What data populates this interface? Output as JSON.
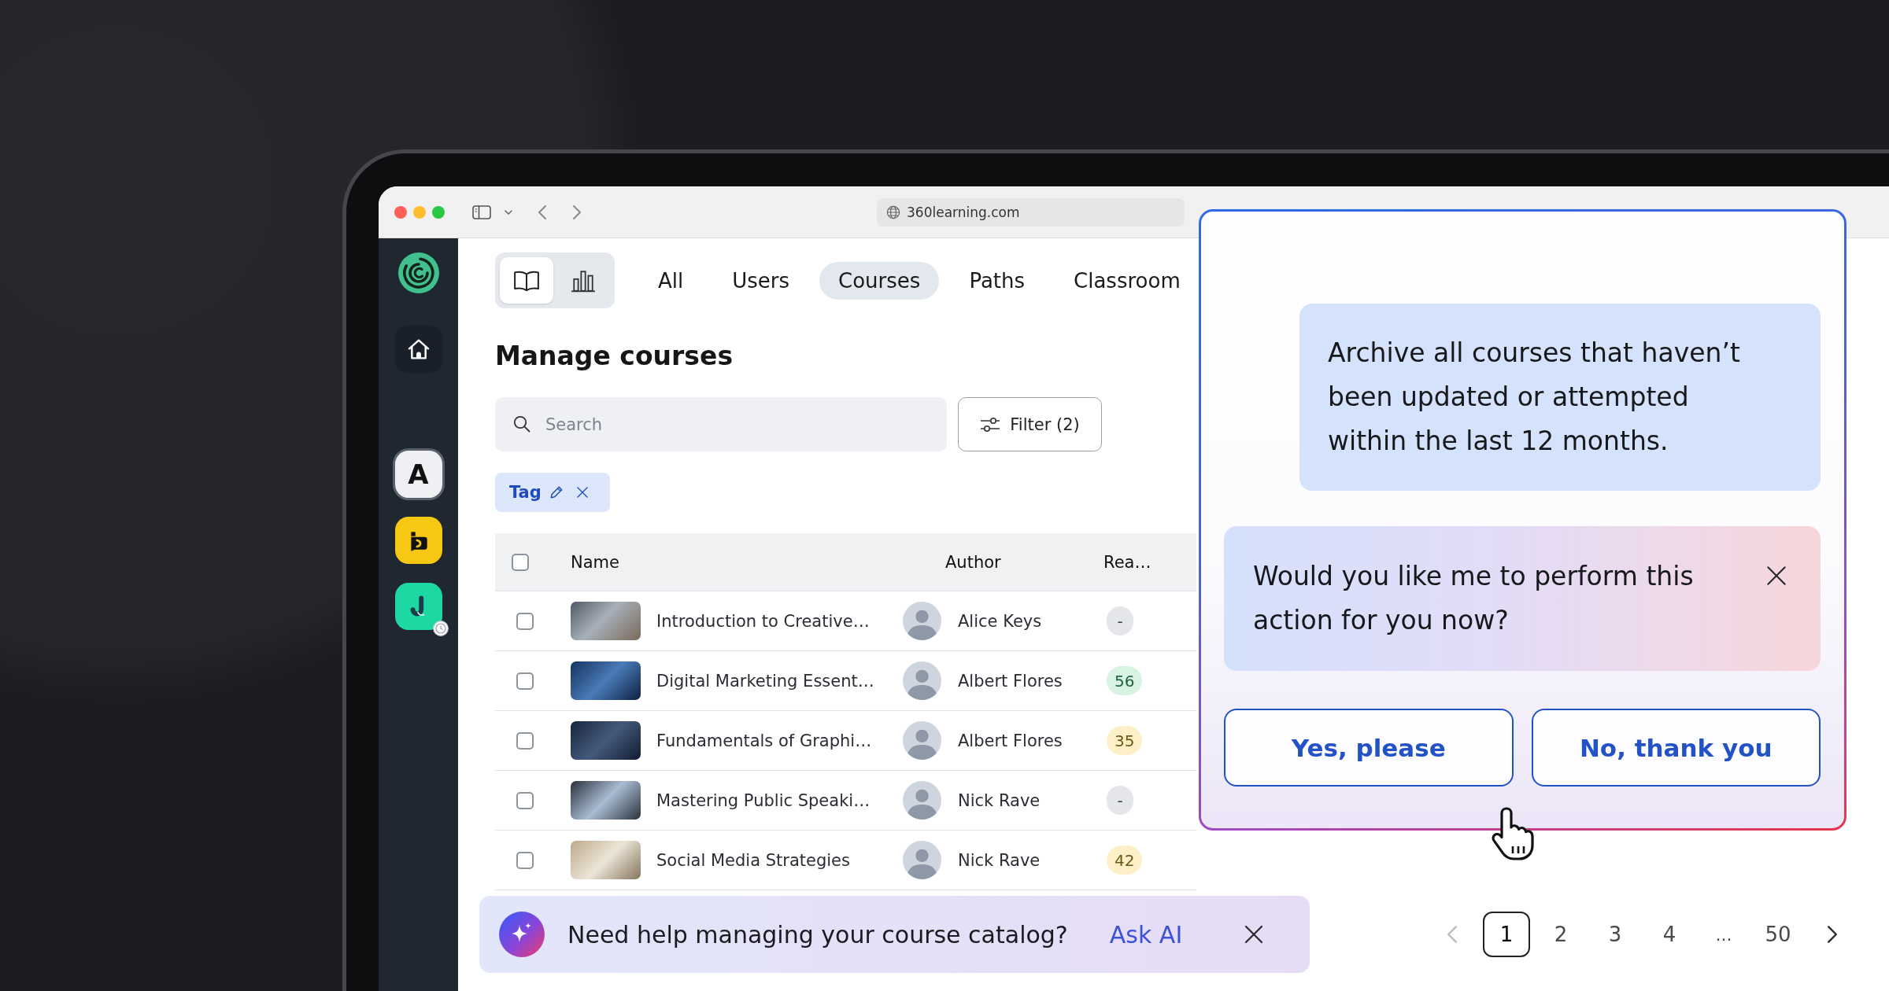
{
  "browser": {
    "url": "360learning.com"
  },
  "sidebar": {
    "apps": [
      {
        "kind": "letter",
        "label": "A",
        "color": "#eef0f4",
        "selected": true,
        "badge": false
      },
      {
        "kind": "bracket",
        "color": "#f6c814",
        "selected": false,
        "badge": false
      },
      {
        "kind": "hook",
        "color": "#1ed8a3",
        "selected": false,
        "badge": true
      }
    ]
  },
  "view_toggle": [
    {
      "kind": "book",
      "selected": true
    },
    {
      "kind": "chart",
      "selected": false
    }
  ],
  "tabs": [
    {
      "label": "All",
      "selected": false
    },
    {
      "label": "Users",
      "selected": false
    },
    {
      "label": "Courses",
      "selected": true
    },
    {
      "label": "Paths",
      "selected": false
    },
    {
      "label": "Classroom",
      "selected": false
    }
  ],
  "title": "Manage courses",
  "search": {
    "placeholder": "Search"
  },
  "filter_button": {
    "label": "Filter (2)"
  },
  "active_filters": [
    {
      "label": "Tag"
    }
  ],
  "table": {
    "select_all_checked": false,
    "columns": [
      "Name",
      "Author",
      "Rea…"
    ],
    "rows": [
      {
        "checked": false,
        "name": "Introduction to Creative…",
        "author": "Alice Keys",
        "reads": {
          "value": "-",
          "color": "#e4e6ea"
        }
      },
      {
        "checked": false,
        "name": "Digital Marketing Essent…",
        "author": "Albert Flores",
        "reads": {
          "value": "56",
          "color": "#d9f3e2"
        }
      },
      {
        "checked": false,
        "name": "Fundamentals of Graphi…",
        "author": "Albert Flores",
        "reads": {
          "value": "35",
          "color": "#fdf0c6"
        }
      },
      {
        "checked": false,
        "name": "Mastering Public Speaki…",
        "author": "Nick Rave",
        "reads": {
          "value": "-",
          "color": "#e4e6ea"
        }
      },
      {
        "checked": false,
        "name": "Social Media Strategies",
        "author": "Nick Rave",
        "reads": {
          "value": "42",
          "color": "#fdf0c6"
        }
      }
    ]
  },
  "assistant_panel": {
    "user_message": "Archive all courses that haven’t been updated or attempted within the last 12 months.",
    "assistant_message": "Would you like me to perform this action for you now?",
    "actions": [
      "Yes, please",
      "No, thank you"
    ]
  },
  "help_banner": {
    "text": "Need help managing your course catalog?",
    "link": "Ask AI"
  },
  "pagination": {
    "previous_disabled": true,
    "next_disabled": false,
    "items": [
      {
        "kind": "page",
        "label": "1",
        "selected": true
      },
      {
        "kind": "page",
        "label": "2",
        "selected": false
      },
      {
        "kind": "page",
        "label": "3",
        "selected": false
      },
      {
        "kind": "page",
        "label": "4",
        "selected": false
      },
      {
        "kind": "gap",
        "label": "...",
        "selected": false
      },
      {
        "kind": "page",
        "label": "50",
        "selected": false
      }
    ]
  }
}
